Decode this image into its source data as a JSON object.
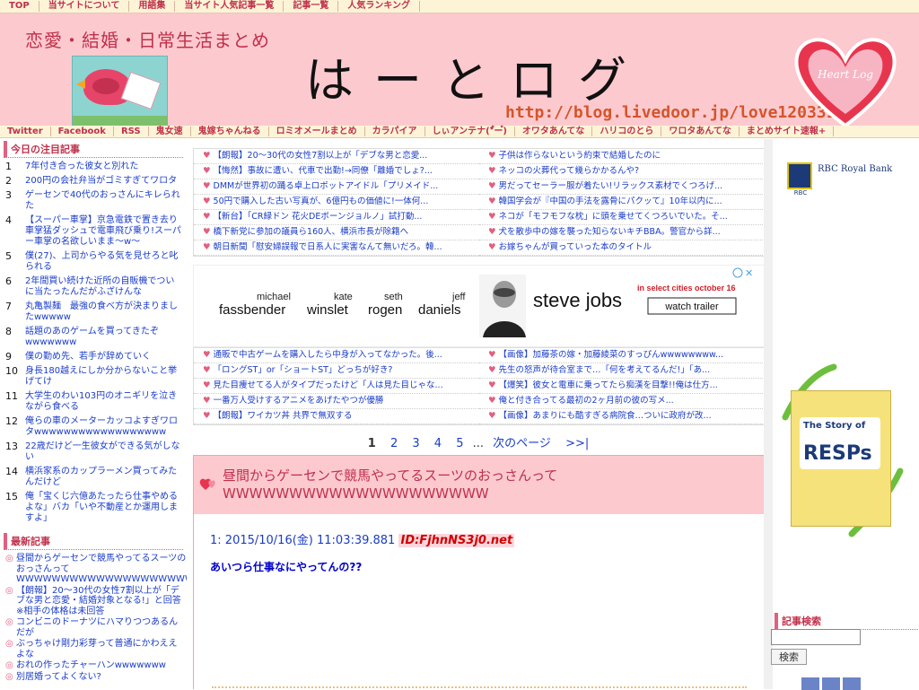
{
  "top_nav": [
    "TOP",
    "当サイトについて",
    "用語集",
    "当サイト人気記事一覧",
    "記事一覧",
    "人気ランキング"
  ],
  "header": {
    "tagline": "恋愛・結婚・日常生活まとめ",
    "title": "はーとログ",
    "url": "http://blog.livedoor.jp/love120331/",
    "logo_text": "Heart Log"
  },
  "sub_nav": [
    "Twitter",
    "Facebook",
    "RSS",
    "鬼女速",
    "鬼嫁ちゃんねる",
    "ロミオメールまとめ",
    "カラパイア",
    "しぃアンテナ(*゚ー゚)",
    "オワタあんてな",
    "ハリコのとら",
    "ワロタあんてな",
    "まとめサイト速報+"
  ],
  "left": {
    "ranking_heading": "今日の注目記事",
    "ranking": [
      {
        "n": "1",
        "t": "7年付き合った彼女と別れた"
      },
      {
        "n": "2",
        "t": "200円の会社弁当がゴミすぎてワロタ"
      },
      {
        "n": "3",
        "t": "ゲーセンで40代のおっさんにキレられた"
      },
      {
        "n": "4",
        "t": "【スーパー車掌】京急電鉄で置き去り車掌猛ダッシュで電車飛び乗り!スーパー車掌の名欲しいまま〜w〜"
      },
      {
        "n": "5",
        "t": "僕(27)、上司からやる気を見せろと叱られる"
      },
      {
        "n": "6",
        "t": "2年間買い続けた近所の自販機でついに当たったんだがふざけんな"
      },
      {
        "n": "7",
        "t": "丸亀製麺　最強の食べ方が決まりましたwwwww"
      },
      {
        "n": "8",
        "t": "話題のあのゲームを買ってきたぞwwwwwww"
      },
      {
        "n": "9",
        "t": "僕の勤め先、若手が辞めていく"
      },
      {
        "n": "10",
        "t": "身長180越えにしか分からないこと挙げてけ"
      },
      {
        "n": "11",
        "t": "大学生のわい103円のオニギリを泣きながら食べる"
      },
      {
        "n": "12",
        "t": "俺らの車のメーターカッコよすぎワロタwwwwwwwwwwwwwwwwww"
      },
      {
        "n": "13",
        "t": "22歳だけど一生彼女ができる気がしない"
      },
      {
        "n": "14",
        "t": "横浜家系のカップラーメン買ってみたんだけど"
      },
      {
        "n": "15",
        "t": "俺「宝くじ六億あたったら仕事やめるよな」バカ「いや不動産とか運用しますよ」"
      }
    ],
    "latest_heading": "最新記事",
    "latest": [
      "昼間からゲーセンで競馬やってるスーツのおっさんってWWWWWWWWWWWWWWWWWWWW",
      "【朗報】20〜30代の女性7割以上が「デブな男と恋愛・結婚対象となる!」と回答 ※相手の体格は未回答",
      "コンビニのドーナツにハマりつつあるんだが",
      "ぶっちゃけ剛力彩芽って普通にかわええよな",
      "おれの作ったチャーハンwwwwwww",
      "別居婚ってよくない?"
    ]
  },
  "linkbox1": {
    "left": [
      "【朗報】20〜30代の女性7割以上が「デブな男と恋愛...",
      "【悔然】事故に遭い、代車で出勤!→同僚「離婚でしょ?...",
      "DMMが世界初の踊る卓上ロボットアイドル「プリメイド...",
      "50円で購入した古い写真が、6億円もの価値に!一体何...",
      "【新台】「CR緑ドン 花火DEボーンジョルノ」試打動...",
      "橋下新党に参加の議員ら160人、横浜市長が除籍へ",
      "朝日新聞「慰安婦誤報で日系人に実害なんて無いだろ。韓..."
    ],
    "right": [
      "子供は作らないという約束で結婚したのに",
      "ネッコの火葬代って幾らかかるんや?",
      "男だってセーラー服が着たい!リラックス素材でくつろげ...",
      "韓国学会が『中国の手法を露骨にパクッて』10年以内に...",
      "ネコが「モフモフな枕」に頭を乗せてくつろいでいた。そ...",
      "犬を散歩中の嫁を襲った知らないキチBBA。警官から詳...",
      "お嫁ちゃんが買っていった本のタイトル"
    ]
  },
  "ad": {
    "names": [
      {
        "first": "michael",
        "last": "fassbender"
      },
      {
        "first": "kate",
        "last": "winslet"
      },
      {
        "first": "seth",
        "last": "rogen"
      },
      {
        "first": "jeff",
        "last": "daniels"
      }
    ],
    "film": "steve jobs",
    "release": "in select cities october 16",
    "cta": "watch trailer"
  },
  "linkbox2": {
    "left": [
      "通販で中古ゲームを購入したら中身が入ってなかった。後...",
      "「ロングST」or「ショートST」どっちが好き?",
      "見た目痩せてる人がタイプだったけど「人は見た目じゃな...",
      "一番万人受けするアニメをあげたやつが優勝",
      "【朗報】ワイカツ丼 共界で無双する"
    ],
    "right": [
      "【画像】加藤茶の嫁・加藤綾菜のすっぴんwwwwwwww...",
      "先生の怒声が待合室まで…「何を考えてるんだ!」「あ...",
      "【爆笑】彼女と電車に乗ってたら痴漢を目撃!!俺は仕方...",
      "俺と付き合ってる最初の2ヶ月前の彼の写メ...",
      "【画像】あまりにも酷すぎる病院食…ついに政府が改..."
    ]
  },
  "pager": {
    "pages": [
      "1",
      "2",
      "3",
      "4",
      "5"
    ],
    "ellipsis": "...",
    "next": "次のページ",
    "last": ">>|"
  },
  "article": {
    "title": "昼間からゲーセンで競馬やってるスーツのおっさんってWWWWWWWWWWWWWWWWWWWW",
    "res_no": "1:",
    "res_date": "2015/10/16(金) 11:03:39.881",
    "res_id": "ID:FjhnNS3j0.net",
    "res_body": "あいつら仕事なにやってんの??"
  },
  "right": {
    "bank": "RBC Royal Bank",
    "bank_mark": "RBC",
    "resp_story": "The Story of",
    "resp_title": "RESPs",
    "search_heading": "記事検索",
    "search_button": "検索"
  },
  "colors": {
    "accent": "#c0304a",
    "link": "#1a3cc8",
    "header_bg": "#fcc9cf"
  }
}
